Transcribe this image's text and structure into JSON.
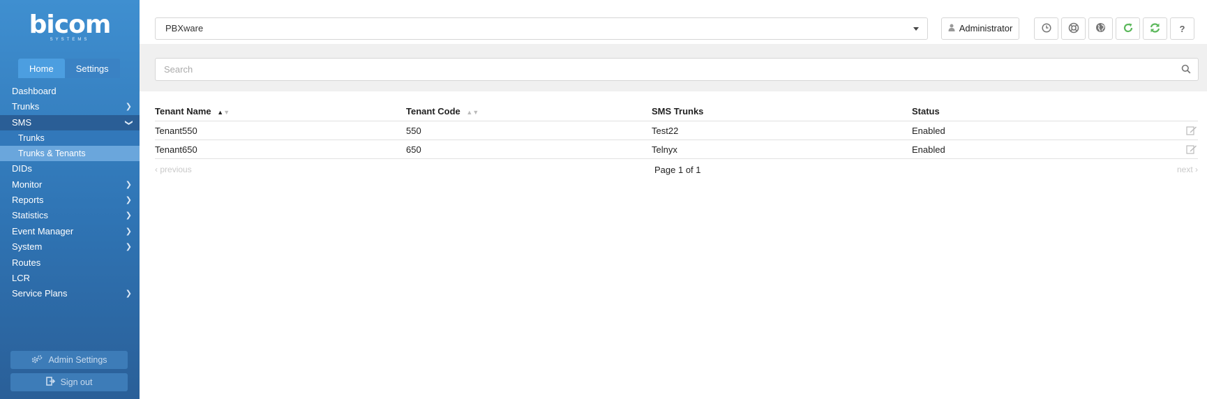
{
  "brand": {
    "logo_text": "bicom",
    "logo_sub": "SYSTEMS"
  },
  "sidebar": {
    "tabs": [
      {
        "label": "Home",
        "active": true
      },
      {
        "label": "Settings",
        "active": false
      }
    ],
    "items": [
      {
        "label": "Dashboard",
        "chevron": false
      },
      {
        "label": "Trunks",
        "chevron": true
      },
      {
        "label": "SMS",
        "chevron": true,
        "expanded": true,
        "active": true
      },
      {
        "label": "Trunks",
        "sub": true
      },
      {
        "label": "Trunks & Tenants",
        "sub": true,
        "active": true
      },
      {
        "label": "DIDs",
        "chevron": false
      },
      {
        "label": "Monitor",
        "chevron": true
      },
      {
        "label": "Reports",
        "chevron": true
      },
      {
        "label": "Statistics",
        "chevron": true
      },
      {
        "label": "Event Manager",
        "chevron": true
      },
      {
        "label": "System",
        "chevron": true
      },
      {
        "label": "Routes",
        "chevron": false
      },
      {
        "label": "LCR",
        "chevron": false
      },
      {
        "label": "Service Plans",
        "chevron": true
      }
    ],
    "admin_settings_label": "Admin Settings",
    "sign_out_label": "Sign out"
  },
  "topbar": {
    "server_select_value": "PBXware",
    "user_label": "Administrator",
    "icons": [
      "clock-icon",
      "support-icon",
      "globe-icon",
      "reload-icon",
      "sync-icon",
      "help-icon"
    ]
  },
  "search": {
    "placeholder": "Search"
  },
  "table": {
    "columns": [
      "Tenant Name",
      "Tenant Code",
      "SMS Trunks",
      "Status"
    ],
    "rows": [
      [
        "Tenant550",
        "550",
        "Test22",
        "Enabled"
      ],
      [
        "Tenant650",
        "650",
        "Telnyx",
        "Enabled"
      ]
    ]
  },
  "pagination": {
    "previous_label": "previous",
    "page_info": "Page 1 of 1",
    "next_label": "next"
  },
  "colors": {
    "sidebar_top": "#3f8fd0",
    "sidebar_bottom": "#2a5f98",
    "accent_green": "#5cb85c"
  }
}
